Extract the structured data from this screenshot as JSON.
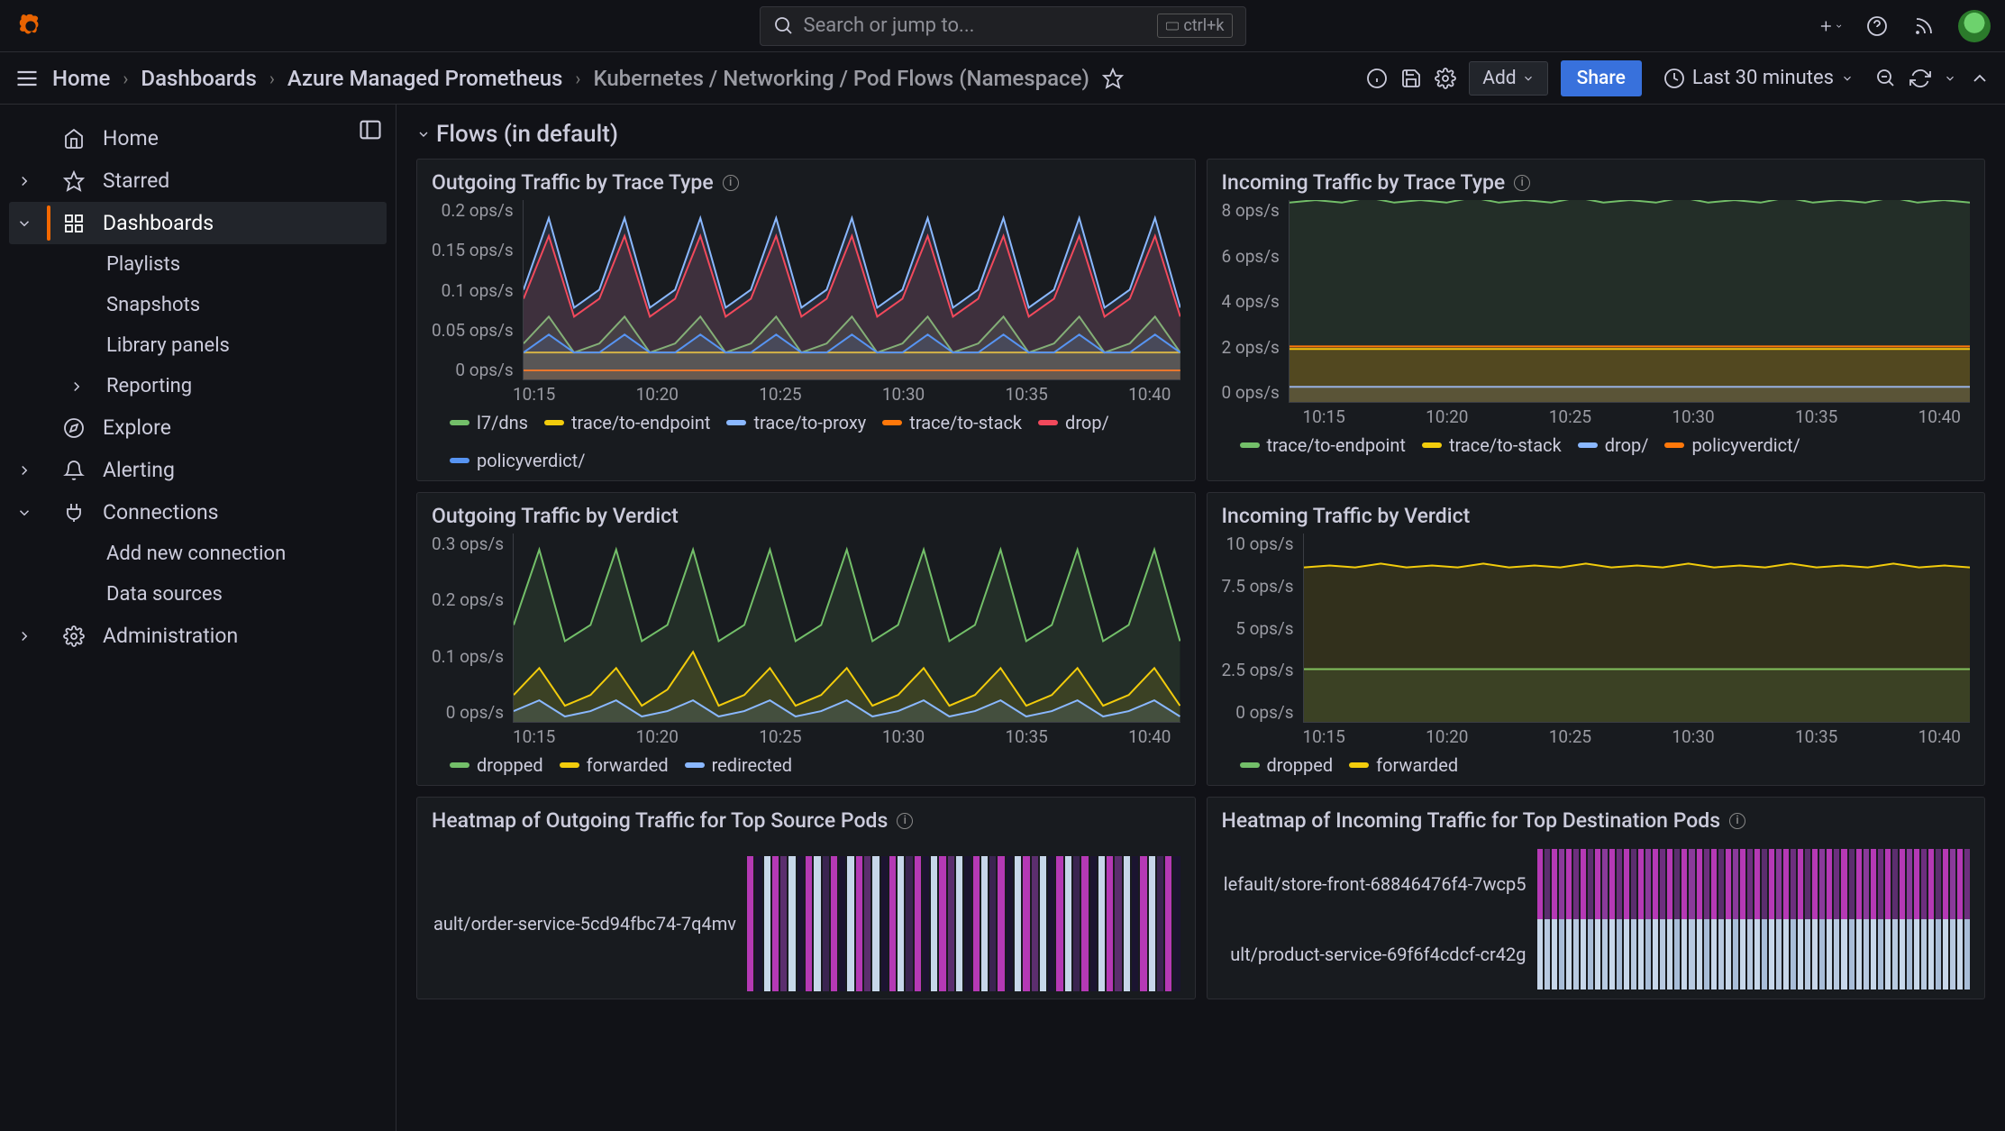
{
  "topbar": {
    "search_placeholder": "Search or jump to...",
    "search_shortcut": "ctrl+k"
  },
  "breadcrumbs": {
    "home": "Home",
    "dashboards": "Dashboards",
    "folder": "Azure Managed Prometheus",
    "dashboard": "Kubernetes / Networking / Pod Flows (Namespace)",
    "add_label": "Add",
    "share_label": "Share",
    "time_label": "Last 30 minutes"
  },
  "sidebar": {
    "items": [
      {
        "label": "Home"
      },
      {
        "label": "Starred"
      },
      {
        "label": "Dashboards"
      },
      {
        "label": "Playlists"
      },
      {
        "label": "Snapshots"
      },
      {
        "label": "Library panels"
      },
      {
        "label": "Reporting"
      },
      {
        "label": "Explore"
      },
      {
        "label": "Alerting"
      },
      {
        "label": "Connections"
      },
      {
        "label": "Add new connection"
      },
      {
        "label": "Data sources"
      },
      {
        "label": "Administration"
      }
    ]
  },
  "row_title": "Flows (in default)",
  "panels": {
    "p1": {
      "title": "Outgoing Traffic by Trace Type",
      "legend": [
        "l7/dns",
        "trace/to-endpoint",
        "trace/to-proxy",
        "trace/to-stack",
        "drop/",
        "policyverdict/"
      ]
    },
    "p2": {
      "title": "Incoming Traffic by Trace Type",
      "legend": [
        "trace/to-endpoint",
        "trace/to-stack",
        "drop/",
        "policyverdict/"
      ]
    },
    "p3": {
      "title": "Outgoing Traffic by Verdict",
      "legend": [
        "dropped",
        "forwarded",
        "redirected"
      ]
    },
    "p4": {
      "title": "Incoming Traffic by Verdict",
      "legend": [
        "dropped",
        "forwarded"
      ]
    },
    "p5": {
      "title": "Heatmap of Outgoing Traffic for Top Source Pods",
      "rows": [
        "ault/order-service-5cd94fbc74-7q4mv"
      ]
    },
    "p6": {
      "title": "Heatmap of Incoming Traffic for Top Destination Pods",
      "rows": [
        "lefault/store-front-68846476f4-7wcp5",
        "ult/product-service-69f6f4cdcf-cr42g"
      ]
    }
  },
  "chart_data": [
    {
      "type": "line",
      "title": "Outgoing Traffic by Trace Type",
      "xlabel": "",
      "ylabel": "ops/s",
      "ylim": [
        0,
        0.2
      ],
      "yticks": [
        "0 ops/s",
        "0.05 ops/s",
        "0.1 ops/s",
        "0.15 ops/s",
        "0.2 ops/s"
      ],
      "xticks": [
        "10:15",
        "10:20",
        "10:25",
        "10:30",
        "10:35",
        "10:40"
      ],
      "series": [
        {
          "name": "l7/dns",
          "color": "#73bf69",
          "values": [
            0.04,
            0.07,
            0.03,
            0.04,
            0.07,
            0.03,
            0.04,
            0.07,
            0.03,
            0.04,
            0.07,
            0.03,
            0.04,
            0.07,
            0.03,
            0.04,
            0.07,
            0.03,
            0.04,
            0.07,
            0.03,
            0.04,
            0.07,
            0.03,
            0.04,
            0.07,
            0.03
          ]
        },
        {
          "name": "trace/to-endpoint",
          "color": "#f2cc0c",
          "values": [
            0.03,
            0.03,
            0.03,
            0.03,
            0.03,
            0.03,
            0.03,
            0.03,
            0.03,
            0.03,
            0.03,
            0.03,
            0.03,
            0.03,
            0.03,
            0.03,
            0.03,
            0.03,
            0.03,
            0.03,
            0.03,
            0.03,
            0.03,
            0.03,
            0.03,
            0.03,
            0.03
          ]
        },
        {
          "name": "trace/to-proxy",
          "color": "#8ab8ff",
          "values": [
            0.1,
            0.18,
            0.08,
            0.1,
            0.18,
            0.08,
            0.1,
            0.18,
            0.08,
            0.1,
            0.18,
            0.08,
            0.1,
            0.18,
            0.08,
            0.1,
            0.18,
            0.08,
            0.1,
            0.18,
            0.08,
            0.1,
            0.18,
            0.08,
            0.1,
            0.18,
            0.08
          ]
        },
        {
          "name": "trace/to-stack",
          "color": "#ff780a",
          "values": [
            0.01,
            0.01,
            0.01,
            0.01,
            0.01,
            0.01,
            0.01,
            0.01,
            0.01,
            0.01,
            0.01,
            0.01,
            0.01,
            0.01,
            0.01,
            0.01,
            0.01,
            0.01,
            0.01,
            0.01,
            0.01,
            0.01,
            0.01,
            0.01,
            0.01,
            0.01,
            0.01
          ]
        },
        {
          "name": "drop/",
          "color": "#f2495c",
          "values": [
            0.09,
            0.16,
            0.07,
            0.09,
            0.16,
            0.07,
            0.09,
            0.16,
            0.07,
            0.09,
            0.16,
            0.07,
            0.09,
            0.16,
            0.07,
            0.09,
            0.16,
            0.07,
            0.09,
            0.16,
            0.07,
            0.09,
            0.16,
            0.07,
            0.09,
            0.16,
            0.07
          ]
        },
        {
          "name": "policyverdict/",
          "color": "#5794f2",
          "values": [
            0.03,
            0.05,
            0.03,
            0.03,
            0.05,
            0.03,
            0.03,
            0.05,
            0.03,
            0.03,
            0.05,
            0.03,
            0.03,
            0.05,
            0.03,
            0.03,
            0.05,
            0.03,
            0.03,
            0.05,
            0.03,
            0.03,
            0.05,
            0.03,
            0.03,
            0.05,
            0.03
          ]
        }
      ]
    },
    {
      "type": "line",
      "title": "Incoming Traffic by Trace Type",
      "xlabel": "",
      "ylabel": "ops/s",
      "ylim": [
        0,
        8
      ],
      "yticks": [
        "0 ops/s",
        "2 ops/s",
        "4 ops/s",
        "6 ops/s",
        "8 ops/s"
      ],
      "xticks": [
        "10:15",
        "10:20",
        "10:25",
        "10:30",
        "10:35",
        "10:40"
      ],
      "series": [
        {
          "name": "trace/to-endpoint",
          "color": "#73bf69",
          "values": [
            7.9,
            8.0,
            7.9,
            8.1,
            7.9,
            8.0,
            7.9,
            8.1,
            7.9,
            8.0,
            7.9,
            8.1,
            7.9,
            8.0,
            7.9,
            8.1,
            7.9,
            8.0,
            7.9,
            8.1,
            7.9,
            8.0,
            7.9,
            8.1,
            7.9,
            8.0,
            7.9
          ]
        },
        {
          "name": "trace/to-stack",
          "color": "#f2cc0c",
          "values": [
            2.1,
            2.1,
            2.1,
            2.1,
            2.1,
            2.1,
            2.1,
            2.1,
            2.1,
            2.1,
            2.1,
            2.1,
            2.1,
            2.1,
            2.1,
            2.1,
            2.1,
            2.1,
            2.1,
            2.1,
            2.1,
            2.1,
            2.1,
            2.1,
            2.1,
            2.1,
            2.1
          ]
        },
        {
          "name": "drop/",
          "color": "#8ab8ff",
          "values": [
            0.6,
            0.6,
            0.6,
            0.6,
            0.6,
            0.6,
            0.6,
            0.6,
            0.6,
            0.6,
            0.6,
            0.6,
            0.6,
            0.6,
            0.6,
            0.6,
            0.6,
            0.6,
            0.6,
            0.6,
            0.6,
            0.6,
            0.6,
            0.6,
            0.6,
            0.6,
            0.6
          ]
        },
        {
          "name": "policyverdict/",
          "color": "#ff780a",
          "values": [
            2.2,
            2.2,
            2.2,
            2.2,
            2.2,
            2.2,
            2.2,
            2.2,
            2.2,
            2.2,
            2.2,
            2.2,
            2.2,
            2.2,
            2.2,
            2.2,
            2.2,
            2.2,
            2.2,
            2.2,
            2.2,
            2.2,
            2.2,
            2.2,
            2.2,
            2.2,
            2.2
          ]
        }
      ]
    },
    {
      "type": "line",
      "title": "Outgoing Traffic by Verdict",
      "xlabel": "",
      "ylabel": "ops/s",
      "ylim": [
        0,
        0.35
      ],
      "yticks": [
        "0 ops/s",
        "0.1 ops/s",
        "0.2 ops/s",
        "0.3 ops/s"
      ],
      "xticks": [
        "10:15",
        "10:20",
        "10:25",
        "10:30",
        "10:35",
        "10:40"
      ],
      "series": [
        {
          "name": "dropped",
          "color": "#73bf69",
          "values": [
            0.18,
            0.32,
            0.15,
            0.18,
            0.32,
            0.15,
            0.18,
            0.32,
            0.15,
            0.18,
            0.32,
            0.15,
            0.18,
            0.32,
            0.15,
            0.18,
            0.32,
            0.15,
            0.18,
            0.32,
            0.15,
            0.18,
            0.32,
            0.15,
            0.18,
            0.32,
            0.15
          ]
        },
        {
          "name": "forwarded",
          "color": "#f2cc0c",
          "values": [
            0.05,
            0.1,
            0.03,
            0.05,
            0.1,
            0.03,
            0.06,
            0.13,
            0.03,
            0.05,
            0.1,
            0.03,
            0.05,
            0.1,
            0.03,
            0.05,
            0.1,
            0.03,
            0.05,
            0.1,
            0.03,
            0.05,
            0.1,
            0.03,
            0.05,
            0.1,
            0.03
          ]
        },
        {
          "name": "redirected",
          "color": "#8ab8ff",
          "values": [
            0.02,
            0.04,
            0.01,
            0.02,
            0.04,
            0.01,
            0.02,
            0.04,
            0.01,
            0.02,
            0.04,
            0.01,
            0.02,
            0.04,
            0.01,
            0.02,
            0.04,
            0.01,
            0.02,
            0.04,
            0.01,
            0.02,
            0.04,
            0.01,
            0.02,
            0.04,
            0.01
          ]
        }
      ]
    },
    {
      "type": "line",
      "title": "Incoming Traffic by Verdict",
      "xlabel": "",
      "ylabel": "ops/s",
      "ylim": [
        0,
        10
      ],
      "yticks": [
        "0 ops/s",
        "2.5 ops/s",
        "5 ops/s",
        "7.5 ops/s",
        "10 ops/s"
      ],
      "xticks": [
        "10:15",
        "10:20",
        "10:25",
        "10:30",
        "10:35",
        "10:40"
      ],
      "series": [
        {
          "name": "dropped",
          "color": "#73bf69",
          "values": [
            2.8,
            2.8,
            2.8,
            2.8,
            2.8,
            2.8,
            2.8,
            2.8,
            2.8,
            2.8,
            2.8,
            2.8,
            2.8,
            2.8,
            2.8,
            2.8,
            2.8,
            2.8,
            2.8,
            2.8,
            2.8,
            2.8,
            2.8,
            2.8,
            2.8,
            2.8,
            2.8
          ]
        },
        {
          "name": "forwarded",
          "color": "#f2cc0c",
          "values": [
            8.2,
            8.3,
            8.2,
            8.4,
            8.2,
            8.3,
            8.2,
            8.4,
            8.2,
            8.3,
            8.2,
            8.4,
            8.2,
            8.3,
            8.2,
            8.4,
            8.2,
            8.3,
            8.2,
            8.4,
            8.2,
            8.3,
            8.2,
            8.4,
            8.2,
            8.3,
            8.2
          ]
        }
      ]
    },
    {
      "type": "heatmap",
      "title": "Heatmap of Outgoing Traffic for Top Source Pods",
      "ylabels": [
        "ault/order-service-5cd94fbc74-7q4mv"
      ],
      "colorscale": [
        "#1b1430",
        "#b539b5",
        "#c7d7ea"
      ]
    },
    {
      "type": "heatmap",
      "title": "Heatmap of Incoming Traffic for Top Destination Pods",
      "ylabels": [
        "lefault/store-front-68846476f4-7wcp5",
        "ult/product-service-69f6f4cdcf-cr42g"
      ],
      "colorscale": [
        "#1b1430",
        "#b539b5",
        "#c7d7ea"
      ]
    }
  ]
}
